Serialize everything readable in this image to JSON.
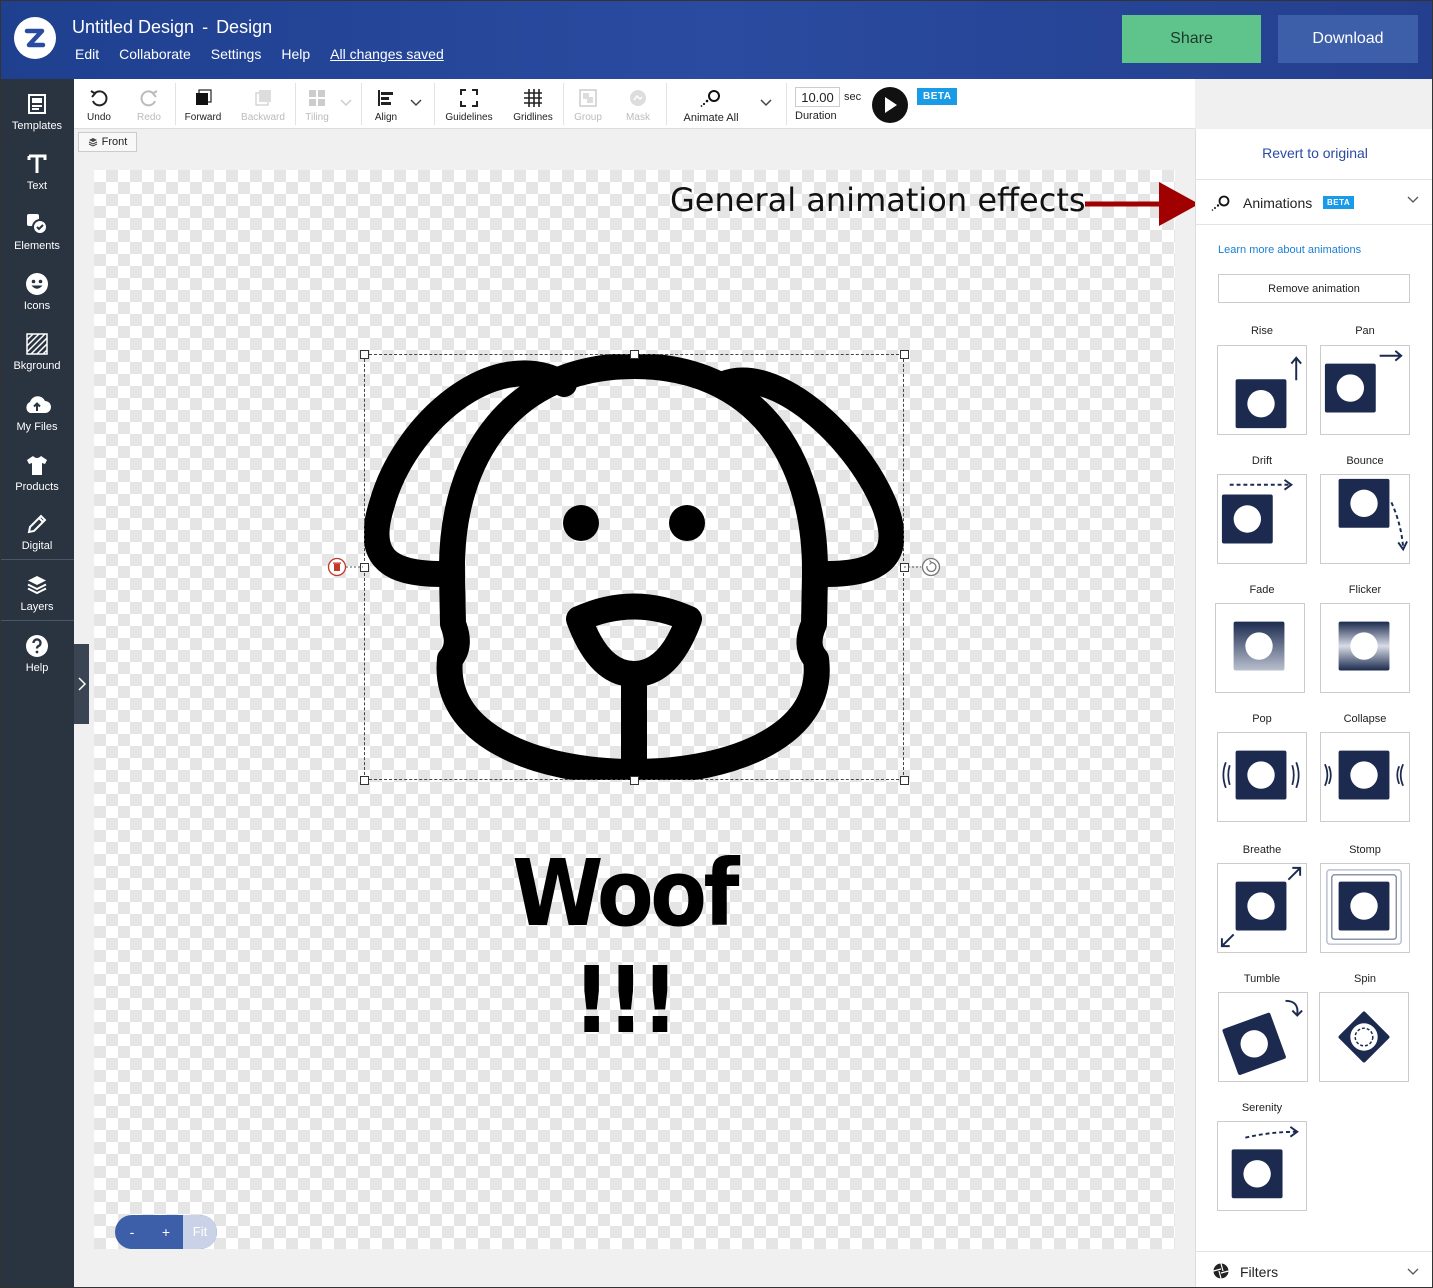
{
  "header": {
    "design_name": "Untitled Design",
    "separator": "-",
    "mode": "Design",
    "menu": [
      "Edit",
      "Collaborate",
      "Settings",
      "Help"
    ],
    "saved_status": "All changes saved",
    "share_label": "Share",
    "download_label": "Download"
  },
  "sidebar": {
    "items": [
      {
        "label": "Templates",
        "icon": "templates-icon"
      },
      {
        "label": "Text",
        "icon": "text-icon"
      },
      {
        "label": "Elements",
        "icon": "elements-icon"
      },
      {
        "label": "Icons",
        "icon": "smiley-icon"
      },
      {
        "label": "Bkground",
        "icon": "background-icon"
      },
      {
        "label": "My Files",
        "icon": "cloud-upload-icon"
      },
      {
        "label": "Products",
        "icon": "tshirt-icon"
      },
      {
        "label": "Digital",
        "icon": "pencil-icon"
      },
      {
        "label": "Layers",
        "icon": "layers-icon"
      },
      {
        "label": "Help",
        "icon": "help-icon"
      }
    ]
  },
  "toolbar": {
    "undo": "Undo",
    "redo": "Redo",
    "forward": "Forward",
    "backward": "Backward",
    "tiling": "Tiling",
    "align": "Align",
    "guidelines": "Guidelines",
    "gridlines": "Gridlines",
    "group": "Group",
    "mask": "Mask",
    "animate_all": "Animate All",
    "duration_value": "10.00",
    "duration_unit": "sec",
    "duration_label": "Duration",
    "beta": "BETA"
  },
  "canvas": {
    "side_tag": "Front",
    "text_element": "Woof !!!",
    "annotation": "General animation effects",
    "zoom_minus": "-",
    "zoom_plus": "+",
    "zoom_fit": "Fit"
  },
  "panel": {
    "revert": "Revert to original",
    "animations_title": "Animations",
    "beta": "BETA",
    "learn_more": "Learn more about animations",
    "remove_animation": "Remove animation",
    "effects": [
      "Rise",
      "Pan",
      "Drift",
      "Bounce",
      "Fade",
      "Flicker",
      "Pop",
      "Collapse",
      "Breathe",
      "Stomp",
      "Tumble",
      "Spin",
      "Serenity"
    ],
    "filters_title": "Filters"
  },
  "colors": {
    "header_bg": "#2a4ba0",
    "share_bg": "#5ec48b",
    "download_bg": "#3d5ea8",
    "sidebar_bg": "#2a3340",
    "tile_navy": "#1b2a4e",
    "annotation_arrow": "#a00000",
    "beta_badge": "#1a9be8"
  }
}
